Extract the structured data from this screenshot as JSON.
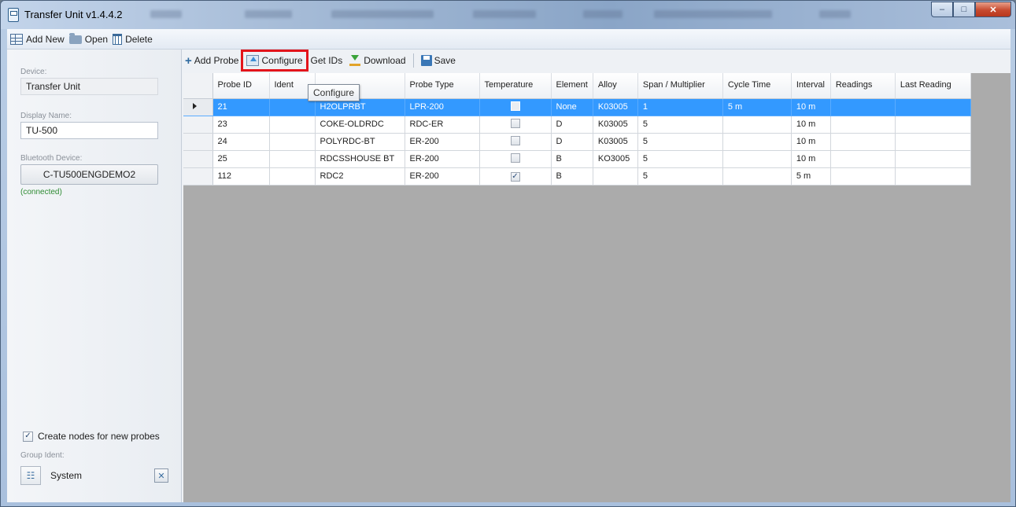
{
  "window": {
    "title": "Transfer Unit v1.4.4.2",
    "minimize_glyph": "‒",
    "maximize_glyph": "□",
    "close_glyph": "✕"
  },
  "menu": {
    "add_new": "Add New",
    "open": "Open",
    "delete": "Delete"
  },
  "left_panel": {
    "device_label": "Device:",
    "device_value": "Transfer Unit",
    "display_name_label": "Display Name:",
    "display_name_value": "TU-500",
    "bluetooth_label": "Bluetooth Device:",
    "bluetooth_value": "C-TU500ENGDEMO2",
    "connection_status": "(connected)",
    "create_nodes_label": "Create nodes for new probes",
    "create_nodes_checked": "✓",
    "group_ident_label": "Group Ident:",
    "group_ident_value": "System",
    "group_icon_glyph": "☷",
    "clear_glyph": "✕"
  },
  "toolbar": {
    "add_probe": "Add Probe",
    "configure": "Configure",
    "get_ids": "Get IDs",
    "download": "Download",
    "save": "Save",
    "plus_glyph": "+"
  },
  "tooltip": "Configure",
  "grid": {
    "columns": {
      "probe_id": "Probe ID",
      "ident": "Ident",
      "name": "",
      "probe_type": "Probe Type",
      "temperature": "Temperature",
      "element": "Element",
      "alloy": "Alloy",
      "span": "Span / Multiplier",
      "cycle_time": "Cycle Time",
      "interval": "Interval",
      "readings": "Readings",
      "last_reading": "Last Reading"
    },
    "rows": [
      {
        "probe_id": "21",
        "ident": "",
        "name": "H2OLPRBT",
        "probe_type": "LPR-200",
        "temperature": "",
        "element": "None",
        "alloy": "K03005",
        "span": "1",
        "cycle_time": "5 m",
        "interval": "10 m",
        "readings": "",
        "last_reading": ""
      },
      {
        "probe_id": "23",
        "ident": "",
        "name": "COKE-OLDRDC",
        "probe_type": "RDC-ER",
        "temperature": "",
        "element": "D",
        "alloy": "K03005",
        "span": "5",
        "cycle_time": "",
        "interval": "10 m",
        "readings": "",
        "last_reading": ""
      },
      {
        "probe_id": "24",
        "ident": "",
        "name": "POLYRDC-BT",
        "probe_type": "ER-200",
        "temperature": "",
        "element": "D",
        "alloy": "K03005",
        "span": "5",
        "cycle_time": "",
        "interval": "10 m",
        "readings": "",
        "last_reading": ""
      },
      {
        "probe_id": "25",
        "ident": "",
        "name": "RDCSSHOUSE BT",
        "probe_type": "ER-200",
        "temperature": "",
        "element": "B",
        "alloy": "KO3005",
        "span": "5",
        "cycle_time": "",
        "interval": "10 m",
        "readings": "",
        "last_reading": ""
      },
      {
        "probe_id": "112",
        "ident": "",
        "name": "RDC2",
        "probe_type": "ER-200",
        "temperature": "✓",
        "element": "B",
        "alloy": "",
        "span": "5",
        "cycle_time": "",
        "interval": "5 m",
        "readings": "",
        "last_reading": ""
      }
    ]
  },
  "colors": {
    "selection": "#3399ff",
    "highlight_box": "#e3141b",
    "connected_text": "#2e8b32"
  }
}
